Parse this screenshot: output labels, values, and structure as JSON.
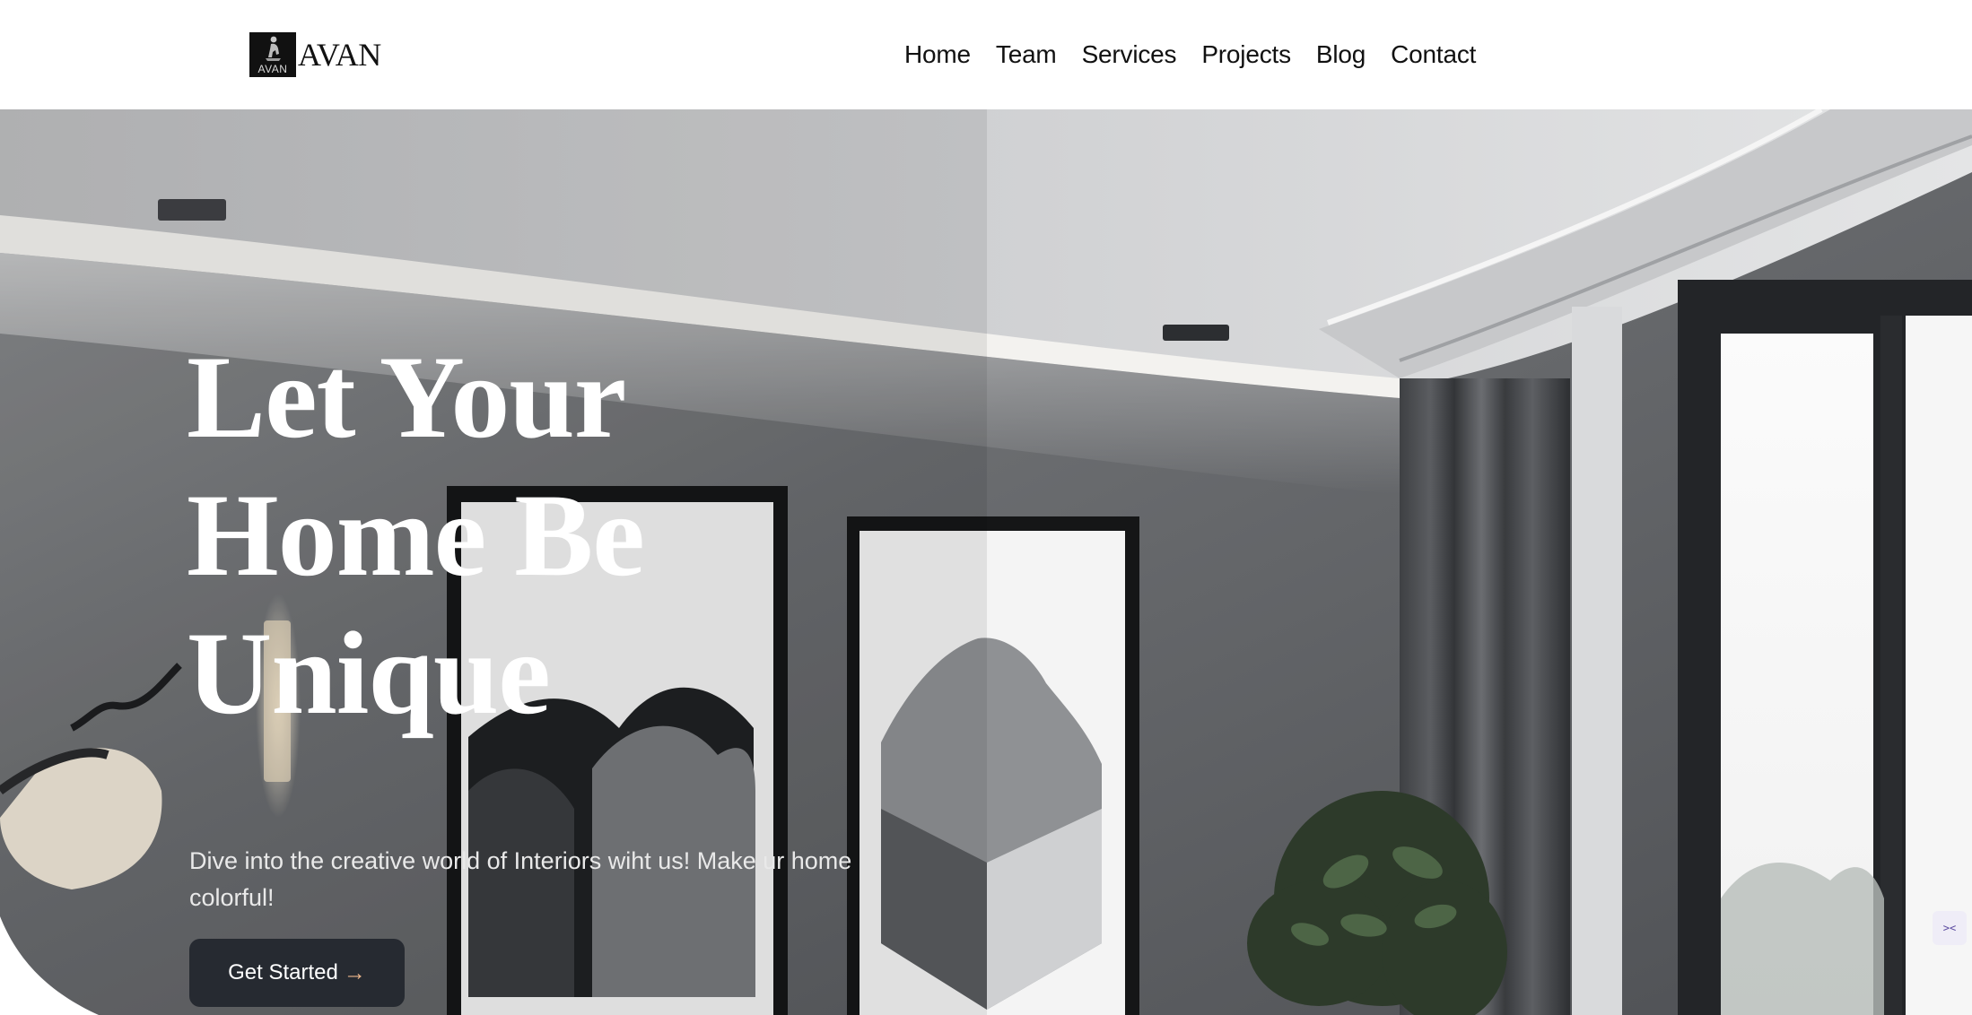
{
  "header": {
    "logo": {
      "name": "AVAN",
      "mark_text": "AVAN",
      "icon": "logo-figure-icon"
    },
    "nav": [
      {
        "label": "Home"
      },
      {
        "label": "Team"
      },
      {
        "label": "Services"
      },
      {
        "label": "Projects"
      },
      {
        "label": "Blog"
      },
      {
        "label": "Contact"
      }
    ]
  },
  "hero": {
    "title_lines": [
      "Let Your",
      "Home Be",
      "Unique"
    ],
    "subtitle": "Dive into the creative world of Interiors wiht us! Make ur home colorful!",
    "cta": {
      "label": "Get Started",
      "icon": "arrow-right-icon",
      "arrow": "→"
    },
    "background_image": "modern-gray-living-room-with-framed-art-lamp-curtains-and-plant"
  },
  "widgets": {
    "translate": {
      "icon": "translate-icon",
      "text": "><"
    }
  },
  "colors": {
    "header_bg": "#ffffff",
    "text_dark": "#111111",
    "hero_title": "#ffffff",
    "cta_bg": "#262a31",
    "cta_arrow": "#e9b48a"
  }
}
